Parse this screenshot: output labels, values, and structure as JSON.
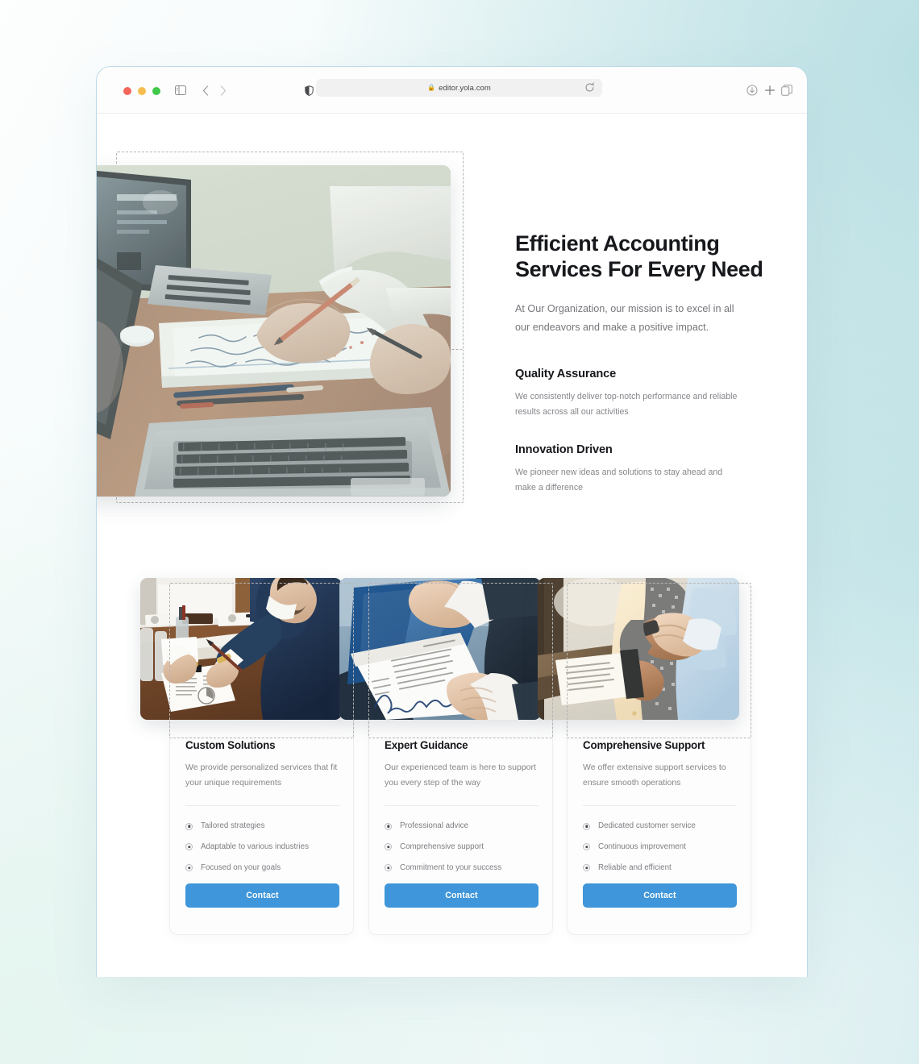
{
  "browser": {
    "url": "editor.yola.com",
    "lock_icon": "lock-icon",
    "traffic_lights": [
      "close-red",
      "minimize-yellow",
      "maximize-green"
    ],
    "icons": {
      "sidebar": "sidebar-toggle-icon",
      "back": "back-chevron-icon",
      "forward": "forward-chevron-icon",
      "shield": "privacy-shield-icon",
      "reload": "reload-icon",
      "download": "download-icon",
      "new_tab": "plus-icon",
      "tab_overview": "tab-overview-icon"
    }
  },
  "hero": {
    "title_line1": "Efficient Accounting",
    "title_line2": "Services For Every Need",
    "subtitle": "At Our Organization, our mission is to excel in all our endeavors and make a positive impact.",
    "image_alt": "hands writing notes beside laptops on a wooden desk",
    "features": [
      {
        "title": "Quality Assurance",
        "text": "We consistently deliver top-notch performance and reliable results across all our activities"
      },
      {
        "title": "Innovation Driven",
        "text": "We pioneer new ideas and solutions to stay ahead and make a difference"
      }
    ]
  },
  "cards": [
    {
      "title": "Custom Solutions",
      "description": "We provide personalized services that fit your unique requirements",
      "image_alt": "businessman in navy suit writing at a conference table",
      "items": [
        "Tailored strategies",
        "Adaptable to various industries",
        "Focused on your goals"
      ],
      "button_label": "Contact"
    },
    {
      "title": "Expert Guidance",
      "description": "Our experienced team is here to support you every step of the way",
      "image_alt": "hands exchanging a signed document in a blue folder",
      "items": [
        "Professional advice",
        "Comprehensive support",
        "Commitment to your success"
      ],
      "button_label": "Contact"
    },
    {
      "title": "Comprehensive Support",
      "description": "We offer extensive support services to ensure smooth operations",
      "image_alt": "two people shaking hands outdoors with a clipboard",
      "items": [
        "Dedicated customer service",
        "Continuous improvement",
        "Reliable and efficient"
      ],
      "button_label": "Contact"
    }
  ],
  "colors": {
    "accent_blue": "#3f96da",
    "heading": "#16181c",
    "body_text": "#85868b",
    "selection_dash": "#b5b5b5",
    "page_background": "#ffffff"
  }
}
